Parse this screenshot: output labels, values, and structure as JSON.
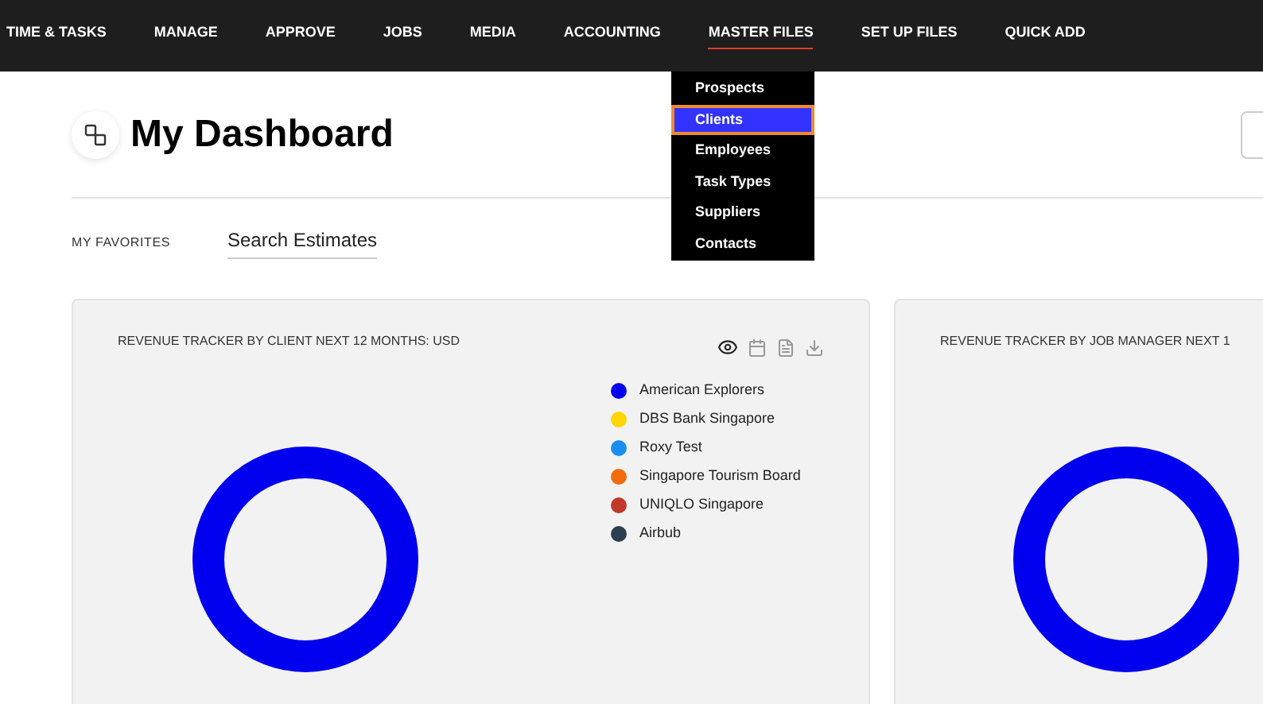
{
  "nav": [
    {
      "label": "TIME & TASKS",
      "selected": false
    },
    {
      "label": "MANAGE",
      "selected": false
    },
    {
      "label": "APPROVE",
      "selected": false
    },
    {
      "label": "JOBS",
      "selected": false
    },
    {
      "label": "MEDIA",
      "selected": false
    },
    {
      "label": "ACCOUNTING",
      "selected": false
    },
    {
      "label": "MASTER FILES",
      "selected": true
    },
    {
      "label": "SET UP FILES",
      "selected": false
    },
    {
      "label": "QUICK ADD",
      "selected": false
    }
  ],
  "dropdown": [
    {
      "label": "Prospects",
      "selected": false
    },
    {
      "label": "Clients",
      "selected": true
    },
    {
      "label": "Employees",
      "selected": false
    },
    {
      "label": "Task Types",
      "selected": false
    },
    {
      "label": "Suppliers",
      "selected": false
    },
    {
      "label": "Contacts",
      "selected": false
    }
  ],
  "page": {
    "title": "My Dashboard"
  },
  "favorites": {
    "label": "MY FAVORITES",
    "items": [
      "Search Estimates"
    ]
  },
  "cards": [
    {
      "title": "REVENUE TRACKER BY CLIENT NEXT 12 MONTHS: USD",
      "toolbar": true,
      "legend": [
        {
          "name": "American Explorers",
          "color": "#0000ee"
        },
        {
          "name": "DBS Bank Singapore",
          "color": "#ffd600"
        },
        {
          "name": "Roxy Test",
          "color": "#1a8fef"
        },
        {
          "name": "Singapore Tourism Board",
          "color": "#f26c0d"
        },
        {
          "name": "UNIQLO Singapore",
          "color": "#c0392b"
        },
        {
          "name": "Airbub",
          "color": "#2c3e50"
        }
      ]
    },
    {
      "title": "REVENUE TRACKER BY JOB MANAGER NEXT 1",
      "toolbar": false
    }
  ]
}
